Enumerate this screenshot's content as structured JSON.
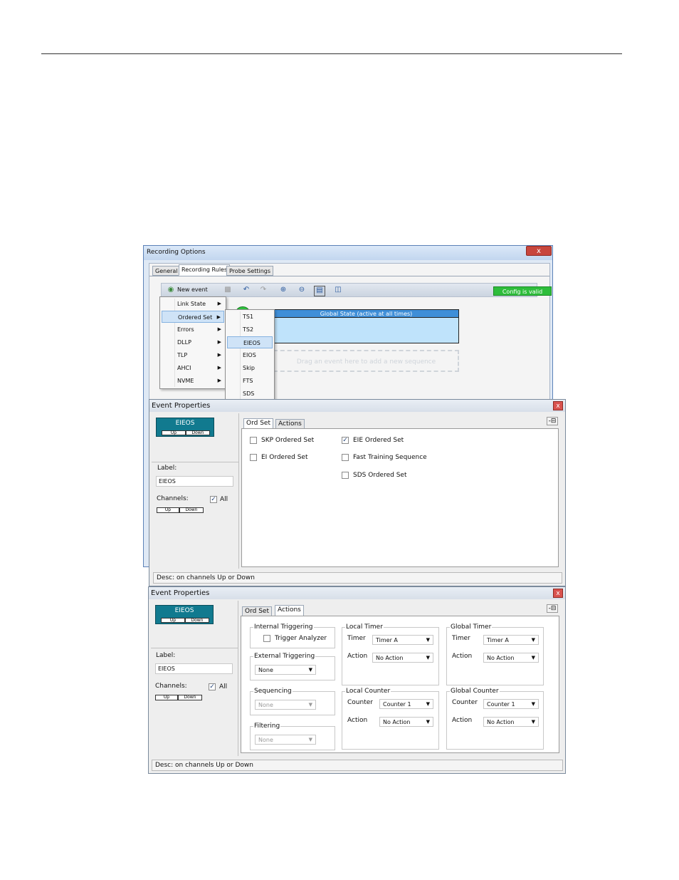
{
  "recording_options": {
    "title": "Recording Options",
    "close": "x",
    "tabs": [
      "General",
      "Recording Rules",
      "Probe Settings"
    ],
    "new_event": "New event",
    "config_status": "Config is valid",
    "menu": [
      "Link State",
      "Ordered Set",
      "Errors",
      "DLLP",
      "TLP",
      "AHCI",
      "NVME"
    ],
    "submenu": [
      "TS1",
      "TS2",
      "EIEOS",
      "EIOS",
      "Skip",
      "FTS",
      "SDS"
    ],
    "global_state": "Global State (active at all times)",
    "drop_hint": "Drag an event here to add a new sequence"
  },
  "event_props_1": {
    "title": "Event Properties",
    "close": "x",
    "event_name": "EIEOS",
    "up": "Up",
    "down": "Down",
    "label_caption": "Label:",
    "label_value": "EIEOS",
    "channels_caption": "Channels:",
    "all": "All",
    "tabs": [
      "Ord Set",
      "Actions"
    ],
    "pin": "-⊟",
    "options": [
      {
        "label": "SKP Ordered Set",
        "checked": false
      },
      {
        "label": "EI Ordered Set",
        "checked": false
      },
      {
        "label": "EIE Ordered Set",
        "checked": true
      },
      {
        "label": "Fast Training Sequence",
        "checked": false
      },
      {
        "label": "SDS Ordered Set",
        "checked": false
      }
    ],
    "desc": "Desc:  on channels Up or Down"
  },
  "event_props_2": {
    "title": "Event Properties",
    "close": "x",
    "event_name": "EIEOS",
    "up": "Up",
    "down": "Down",
    "label_caption": "Label:",
    "label_value": "EIEOS",
    "channels_caption": "Channels:",
    "all": "All",
    "tabs": [
      "Ord Set",
      "Actions"
    ],
    "pin": "-⊟",
    "internal_triggering": "Internal Triggering",
    "trigger_analyzer": "Trigger Analyzer",
    "external_triggering": "External Triggering",
    "external_value": "None",
    "sequencing": "Sequencing",
    "sequencing_value": "None",
    "filtering": "Filtering",
    "filtering_value": "None",
    "local_timer": "Local Timer",
    "global_timer": "Global Timer",
    "local_counter": "Local Counter",
    "global_counter": "Global Counter",
    "timer_label": "Timer",
    "counter_label": "Counter",
    "action_label": "Action",
    "timer_value": "Timer A",
    "counter_value": "Counter 1",
    "action_value": "No Action",
    "desc": "Desc:  on channels Up or Down"
  }
}
